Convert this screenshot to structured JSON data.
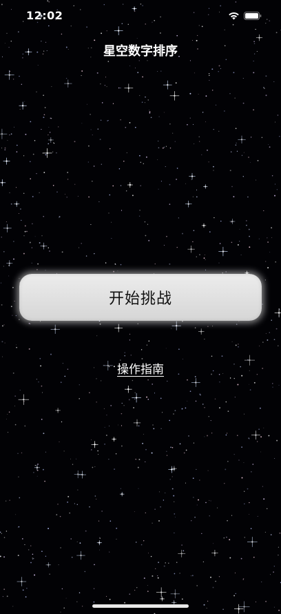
{
  "status_bar": {
    "time": "12:02",
    "icons": [
      "wifi-icon",
      "battery-icon"
    ]
  },
  "header": {
    "title": "星空数字排序"
  },
  "main": {
    "start_button_label": "开始挑战",
    "guide_link_label": "操作指南"
  },
  "colors": {
    "background": "#020205",
    "button_fill": "#e2e2e2",
    "button_text": "#111111",
    "text": "#ffffff"
  }
}
